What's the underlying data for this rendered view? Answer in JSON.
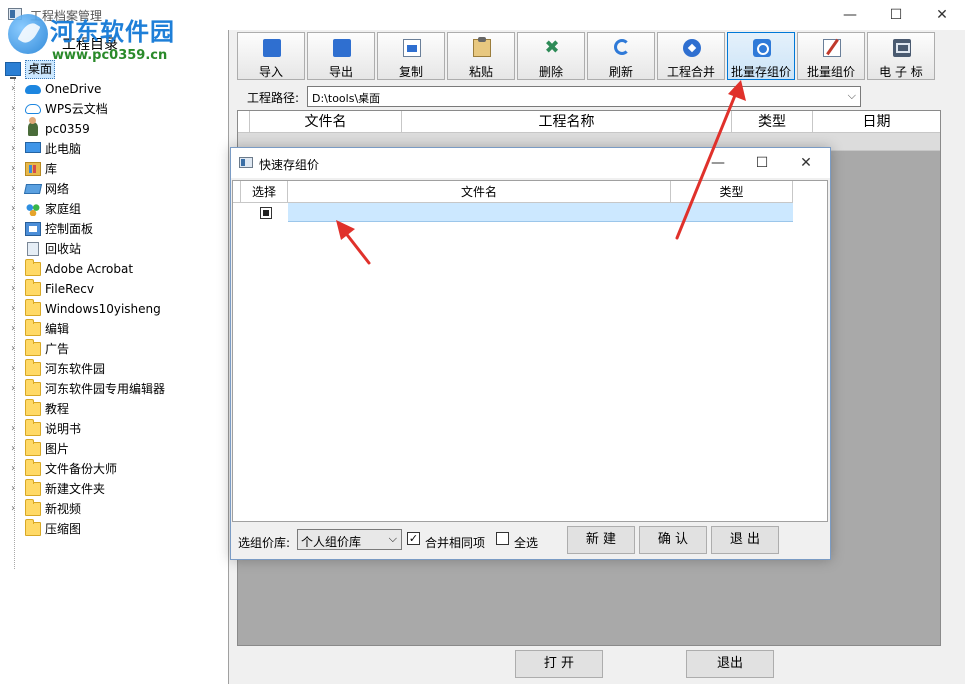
{
  "window": {
    "title": "工程档案管理",
    "min": "—",
    "max": "☐",
    "close": "✕"
  },
  "watermark": {
    "name": "河东软件园",
    "url": "www.pc0359.cn"
  },
  "tree": {
    "header": "工程目录",
    "root": "桌面",
    "items": [
      {
        "label": "OneDrive",
        "icon": "cloud-icon"
      },
      {
        "label": "WPS云文档",
        "icon": "cloud-outline-icon"
      },
      {
        "label": "pc0359",
        "icon": "user-icon"
      },
      {
        "label": "此电脑",
        "icon": "computer-icon"
      },
      {
        "label": "库",
        "icon": "library-icon"
      },
      {
        "label": "网络",
        "icon": "network-icon"
      },
      {
        "label": "家庭组",
        "icon": "homegroup-icon"
      },
      {
        "label": "控制面板",
        "icon": "control-panel-icon"
      },
      {
        "label": "回收站",
        "icon": "recycle-bin-icon"
      },
      {
        "label": "Adobe Acrobat",
        "icon": "folder-icon"
      },
      {
        "label": "FileRecv",
        "icon": "folder-icon"
      },
      {
        "label": "Windows10yisheng",
        "icon": "folder-icon"
      },
      {
        "label": "编辑",
        "icon": "folder-icon"
      },
      {
        "label": "广告",
        "icon": "folder-icon"
      },
      {
        "label": "河东软件园",
        "icon": "folder-icon"
      },
      {
        "label": "河东软件园专用编辑器",
        "icon": "folder-icon"
      },
      {
        "label": "教程",
        "icon": "folder-icon"
      },
      {
        "label": "说明书",
        "icon": "folder-icon"
      },
      {
        "label": "图片",
        "icon": "folder-icon"
      },
      {
        "label": "文件备份大师",
        "icon": "folder-icon"
      },
      {
        "label": "新建文件夹",
        "icon": "folder-icon"
      },
      {
        "label": "新视频",
        "icon": "folder-icon"
      },
      {
        "label": "压缩图",
        "icon": "folder-icon"
      }
    ]
  },
  "toolbar": {
    "buttons": [
      {
        "label": "导入",
        "icon": "import-icon"
      },
      {
        "label": "导出",
        "icon": "export-icon"
      },
      {
        "label": "复制",
        "icon": "copy-icon"
      },
      {
        "label": "粘贴",
        "icon": "paste-icon"
      },
      {
        "label": "删除",
        "icon": "delete-icon"
      },
      {
        "label": "刷新",
        "icon": "refresh-icon"
      },
      {
        "label": "工程合并",
        "icon": "merge-icon"
      },
      {
        "label": "批量存组价",
        "icon": "gears-icon",
        "active": true
      },
      {
        "label": "批量组价",
        "icon": "pencil-icon"
      },
      {
        "label": "电 子 标",
        "icon": "briefcase-icon"
      }
    ]
  },
  "path": {
    "label": "工程路径:",
    "value": "D:\\tools\\桌面"
  },
  "main_table": {
    "columns": [
      "文件名",
      "工程名称",
      "类型",
      "日期"
    ]
  },
  "main_buttons": {
    "open": "打 开",
    "exit": "退出"
  },
  "dialog": {
    "title": "快速存组价",
    "min": "—",
    "max": "☐",
    "close": "✕",
    "columns": [
      "选择",
      "文件名",
      "类型"
    ],
    "lib_label": "选组价库:",
    "lib_value": "个人组价库",
    "merge_label": "合并相同项",
    "merge_checked": "✓",
    "select_all_label": "全选",
    "new_btn": "新 建",
    "confirm_btn": "确 认",
    "exit_btn": "退 出"
  },
  "colors": {
    "accent": "#0078d7",
    "arrow": "#e0312b",
    "selection": "#cce8ff"
  }
}
